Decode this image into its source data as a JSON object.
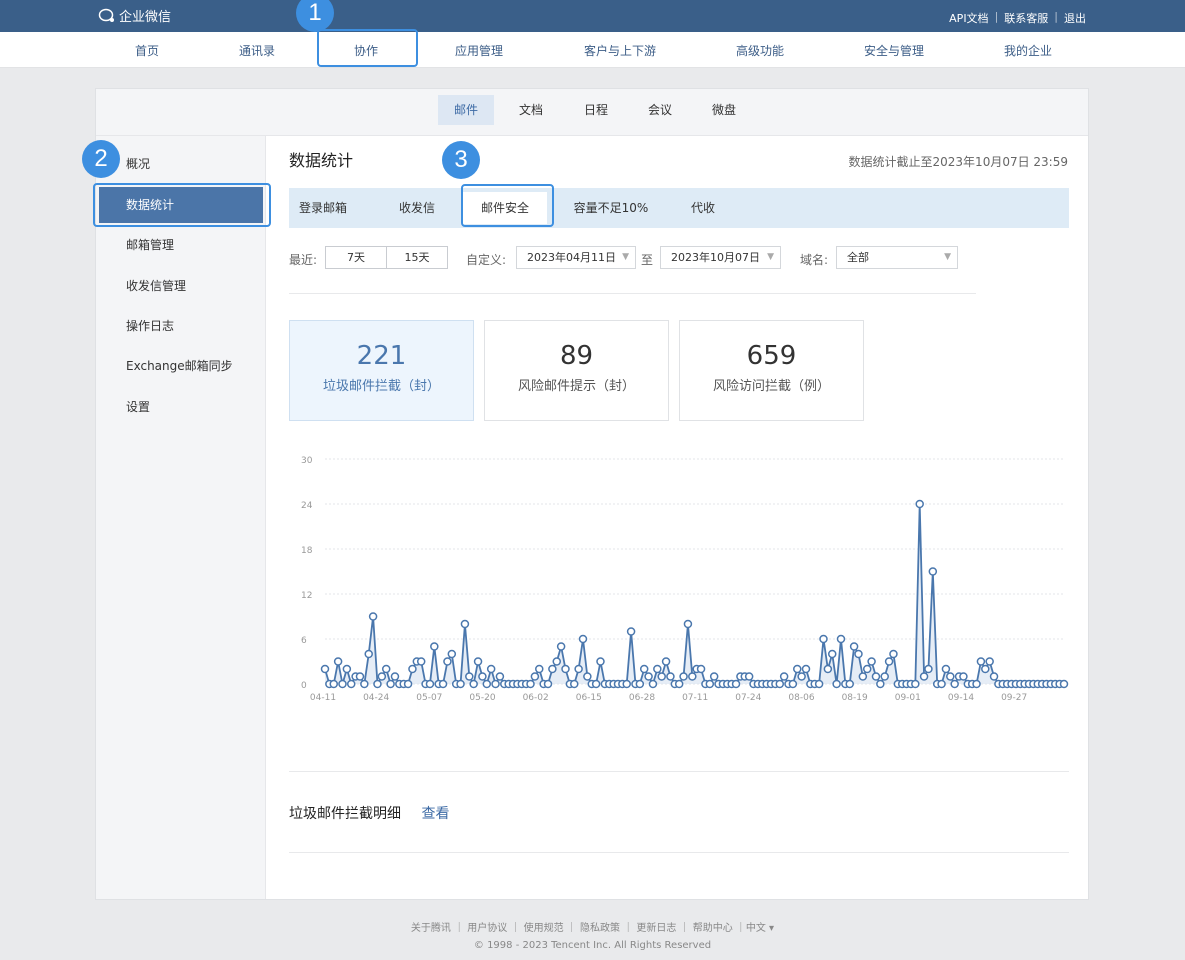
{
  "topbar": {
    "logo_text": "企业微信",
    "links": [
      "API文档",
      "联系客服",
      "退出"
    ]
  },
  "main_nav": [
    "首页",
    "通讯录",
    "协作",
    "应用管理",
    "客户与上下游",
    "高级功能",
    "安全与管理",
    "我的企业"
  ],
  "sub_nav": [
    "邮件",
    "文档",
    "日程",
    "会议",
    "微盘"
  ],
  "sidebar": [
    "概况",
    "数据统计",
    "邮箱管理",
    "收发信管理",
    "操作日志",
    "Exchange邮箱同步",
    "设置"
  ],
  "content": {
    "title": "数据统计",
    "as_of": "数据统计截止至2023年10月07日 23:59",
    "tabs": [
      "登录邮箱",
      "收发信",
      "邮件安全",
      "容量不足10%",
      "代收"
    ],
    "filters": {
      "recent_label": "最近:",
      "btn_7": "7天",
      "btn_15": "15天",
      "custom_label": "自定义:",
      "date_from": "2023年04月11日",
      "to_label": "至",
      "date_to": "2023年10月07日",
      "domain_label": "域名:",
      "domain_value": "全部"
    },
    "stats": [
      {
        "num": "221",
        "cap": "垃圾邮件拦截（封）"
      },
      {
        "num": "89",
        "cap": "风险邮件提示（封）"
      },
      {
        "num": "659",
        "cap": "风险访问拦截（例）"
      }
    ],
    "detail_label": "垃圾邮件拦截明细",
    "detail_link": "查看"
  },
  "footer": {
    "links": "关于腾讯 ｜ 用户协议 ｜ 使用规范 ｜ 隐私政策 ｜ 更新日志 ｜ 帮助中心 ｜中文 ▾",
    "copyright": "© 1998 - 2023 Tencent Inc. All Rights Reserved"
  },
  "annotations": [
    "1",
    "2",
    "3"
  ],
  "colors": {
    "accent": "#4b75a8",
    "topbar": "#3a5f89",
    "badge": "#3d8fe0",
    "line": "#4a77ad"
  },
  "chart_data": {
    "type": "line",
    "ylim": [
      0,
      30
    ],
    "yticks": [
      0,
      6,
      12,
      18,
      24,
      30
    ],
    "xtick_labels": [
      "04-11",
      "04-24",
      "05-07",
      "05-20",
      "06-02",
      "06-15",
      "06-28",
      "07-11",
      "07-24",
      "08-06",
      "08-19",
      "09-01",
      "09-14",
      "09-27"
    ],
    "series": [
      {
        "values": [
          2,
          0,
          0,
          3,
          0,
          2,
          0,
          1,
          1,
          0,
          4,
          9,
          0,
          1,
          2,
          0,
          1,
          0,
          0,
          0,
          2,
          3,
          3,
          0,
          0,
          5,
          0,
          0,
          3,
          4,
          0,
          0,
          8,
          1,
          0,
          3,
          1,
          0,
          2,
          0,
          1,
          0,
          0,
          0,
          0,
          0,
          0,
          0,
          1,
          2,
          0,
          0,
          2,
          3,
          5,
          2,
          0,
          0,
          2,
          6,
          1,
          0,
          0,
          3,
          0,
          0,
          0,
          0,
          0,
          0,
          7,
          0,
          0,
          2,
          1,
          0,
          2,
          1,
          3,
          1,
          0,
          0,
          1,
          8,
          1,
          2,
          2,
          0,
          0,
          1,
          0,
          0,
          0,
          0,
          0,
          1,
          1,
          1,
          0,
          0,
          0,
          0,
          0,
          0,
          0,
          1,
          0,
          0,
          2,
          1,
          2,
          0,
          0,
          0,
          6,
          2,
          4,
          0,
          6,
          0,
          0,
          5,
          4,
          1,
          2,
          3,
          1,
          0,
          1,
          3,
          4,
          0,
          0,
          0,
          0,
          0,
          24,
          1,
          2,
          15,
          0,
          0,
          2,
          1,
          0,
          1,
          1,
          0,
          0,
          0,
          3,
          2,
          3,
          1,
          0,
          0,
          0,
          0,
          0,
          0,
          0,
          0,
          0,
          0,
          0,
          0,
          0,
          0,
          0,
          0
        ]
      }
    ]
  }
}
